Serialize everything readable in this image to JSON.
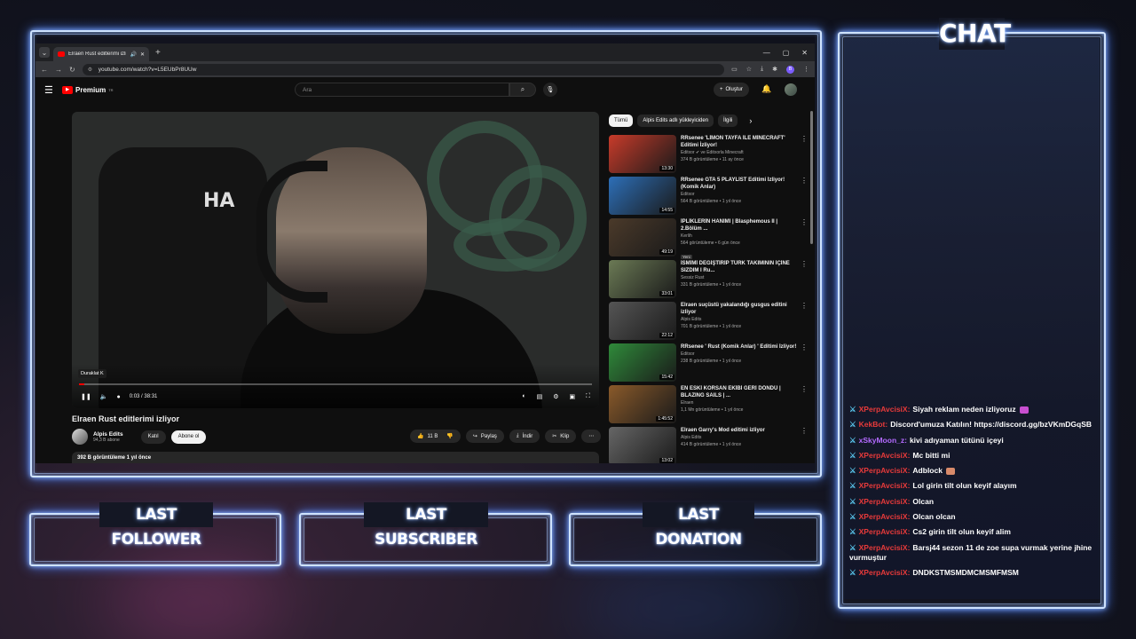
{
  "overlay": {
    "chat_title": "CHAT",
    "last_follower": "LAST FOLLOWER",
    "last_subscriber": "LAST SUBSCRIBER",
    "last_donation": "LAST DONATION",
    "accent": "#8fb8ff"
  },
  "browser": {
    "tab_title": "Elraen Rust editlerimi izliyo",
    "url": "youtube.com/watch?v=L5EUbPr8UUw",
    "profile_letter": "B"
  },
  "youtube": {
    "logo": "Premium",
    "logo_sup": "TR",
    "search_placeholder": "Ara",
    "create_label": "Oluştur",
    "player": {
      "tooltip": "Duraklat",
      "tooltip_key": "K",
      "time": "0:03 / 38:31",
      "progress": 0.0013
    },
    "video_title": "Elraen Rust editlerimi izliyor",
    "channel_name": "Alpis Edits",
    "channel_subs": "94,3 B abone",
    "join_label": "Katıl",
    "subscribe_label": "Abone ol",
    "likes": "11 B",
    "share_label": "Paylaş",
    "download_label": "İndir",
    "clip_label": "Klip",
    "description": "392 B görüntüleme  1 yıl önce",
    "chips": [
      "Tümü",
      "Alpis Edits adlı yükleyiciden",
      "İlgili"
    ],
    "recommendations": [
      {
        "title": "RRsenee 'LİMON TAYFA İLE MİNECRAFT' Editimi İzliyor!",
        "channel": "Editxor ✔ ve Editxorla Minecraft",
        "meta": "374 B görüntüleme • 11 ay önce",
        "duration": "13:30",
        "color": "#c83b2a"
      },
      {
        "title": "RRsenee GTA 5 PLAYLİST Editimi İzliyor! (Komik Anlar)",
        "channel": "Editxor",
        "meta": "564 B görüntüleme • 1 yıl önce",
        "duration": "14:55",
        "color": "#2d6fb8"
      },
      {
        "title": "İPLİKLERİN HANIMI | Blasphemous II | 2.Bölüm ...",
        "channel": "Kerlih",
        "meta": "564 görüntüleme • 6 gün önce",
        "badge": "Yeni",
        "duration": "49:19",
        "color": "#4b3a2a"
      },
      {
        "title": "İSMİMİ DEĞİŞTİRİP TÜRK TAKIMININ İÇİNE SIZDIM I Ru...",
        "channel": "Sessiz Rust",
        "meta": "331 B görüntüleme • 1 yıl önce",
        "duration": "33:01",
        "color": "#6b7a55"
      },
      {
        "title": "Elraen suçüstü yakalandığı gusgus editini izliyor",
        "channel": "Alpis Edits",
        "meta": "701 B görüntüleme • 1 yıl önce",
        "duration": "22:12",
        "color": "#555555"
      },
      {
        "title": "RRsenee ' Rust (Komik Anlar) ' Editimi İzliyor!",
        "channel": "Editxor",
        "meta": "238 B görüntüleme • 1 yıl önce",
        "duration": "15:42",
        "color": "#2f8a3a"
      },
      {
        "title": "EN ESKİ KORSAN EKİBİ GERİ DÖNDÜ | BLAZING SAILS | ...",
        "channel": "Elraen",
        "meta": "1,1 Mn görüntüleme • 1 yıl önce",
        "duration": "1:45:52",
        "color": "#8a5a2a"
      },
      {
        "title": "Elraen Garry's Mod editimi izliyor",
        "channel": "Alpis Edits",
        "meta": "414 B görüntüleme • 1 yıl önce",
        "duration": "13:02",
        "color": "#666666"
      }
    ]
  },
  "chat": {
    "messages": [
      {
        "user": "XPerpAvcisiX",
        "text": "Siyah reklam neden izliyoruz",
        "user_color": "#e83a3a",
        "emote": "#c84fd0"
      },
      {
        "user": "KekBot",
        "text": "Discord'umuza Katılın! https://discord.gg/bzVKmDGqSB",
        "user_color": "#e83a3a"
      },
      {
        "user": "xSkyMoon_z",
        "text": "kivi adıyaman tütünü içeyi",
        "user_color": "#b46bff"
      },
      {
        "user": "XPerpAvcisiX",
        "text": "Mc bitti mi",
        "user_color": "#e83a3a"
      },
      {
        "user": "XPerpAvcisiX",
        "text": "Adblock",
        "user_color": "#e83a3a",
        "emote": "#d88a6a"
      },
      {
        "user": "XPerpAvcisiX",
        "text": "Lol girin tilt olun keyif alayım",
        "user_color": "#e83a3a"
      },
      {
        "user": "XPerpAvcisiX",
        "text": "Olcan",
        "user_color": "#e83a3a"
      },
      {
        "user": "XPerpAvcisiX",
        "text": "Olcan olcan",
        "user_color": "#e83a3a"
      },
      {
        "user": "XPerpAvcisiX",
        "text": "Cs2 girin tilt olun keyif alim",
        "user_color": "#e83a3a"
      },
      {
        "user": "XPerpAvcisiX",
        "text": "Barsj44 sezon 11 de zoe supa vurmak yerine jhine vurmuştur",
        "user_color": "#e83a3a"
      },
      {
        "user": "XPerpAvcisiX",
        "text": "DNDKSTMSMDMCMSMFMSM",
        "user_color": "#e83a3a"
      }
    ]
  }
}
